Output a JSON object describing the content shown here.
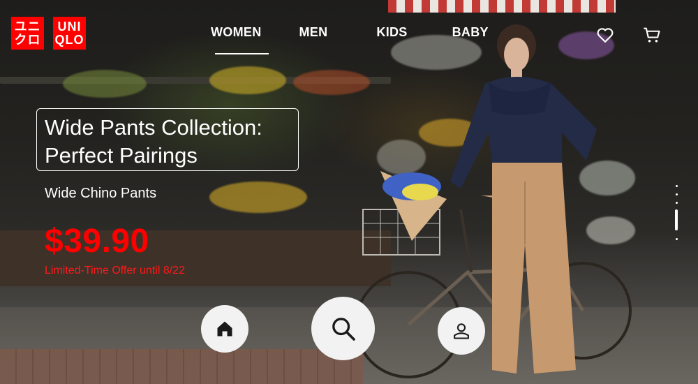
{
  "brand": {
    "logo_left": "ユニ\nクロ",
    "logo_right": "UNI\nQLO",
    "color": "#ff0000"
  },
  "nav": {
    "items": [
      {
        "label": "WOMEN",
        "active": true
      },
      {
        "label": "MEN",
        "active": false
      },
      {
        "label": "KIDS",
        "active": false
      },
      {
        "label": "BABY",
        "active": false
      }
    ]
  },
  "header_icons": {
    "wishlist": "heart-icon",
    "cart": "cart-icon"
  },
  "promo": {
    "title_line1": "Wide Pants Collection:",
    "title_line2": "Perfect Pairings",
    "product": "Wide Chino Pants",
    "price": "$39.90",
    "offer": "Limited-Time Offer until 8/22",
    "price_color": "#ff0000"
  },
  "bottom_nav": {
    "home": "home-icon",
    "search": "search-icon",
    "account": "user-icon"
  }
}
